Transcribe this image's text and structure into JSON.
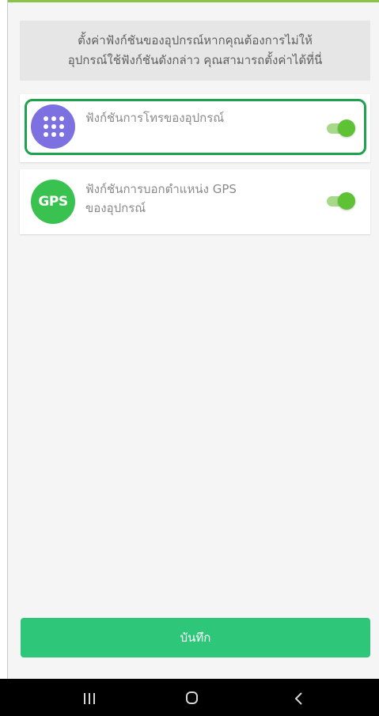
{
  "colors": {
    "top_accent": "#8bc34a",
    "highlight_border": "#1ea24d",
    "phone_icon_bg": "#7d71e2",
    "gps_icon_bg": "#39c24f",
    "toggle_track": "#a8d88a",
    "toggle_knob": "#5dc234",
    "save_button_bg": "#2ec779",
    "navbar_bg": "#000000"
  },
  "banner": {
    "line1": "ตั้งค่าฟังก์ชันของอุปกรณ์หากคุณต้องการไม่ให้",
    "line2": "อุปกรณ์ใช้ฟังก์ชันดังกล่าว คุณสามารถตั้งค่าได้ที่นี่"
  },
  "features": [
    {
      "icon": "dial-grid-icon",
      "label_lines": [
        "ฟังก์ชันการโทรของอุปกรณ์"
      ],
      "enabled": true,
      "highlighted": true
    },
    {
      "icon": "gps-icon",
      "icon_text": "GPS",
      "label_lines": [
        "ฟังก์ชันการบอกตำแหน่ง GPS",
        "ของอุปกรณ์"
      ],
      "enabled": true,
      "highlighted": false
    }
  ],
  "save_button": {
    "label": "บันทึก"
  },
  "navbar": {
    "recent_icon": "recent-apps-icon",
    "home_icon": "home-icon",
    "back_icon": "back-icon"
  }
}
